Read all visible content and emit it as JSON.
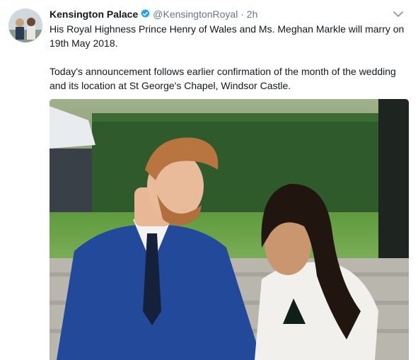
{
  "tweet": {
    "display_name": "Kensington Palace",
    "handle": "@KensingtonRoyal",
    "separator": "·",
    "time": "2h",
    "text_p1": "His Royal Highness Prince Henry of Wales and Ms. Meghan Markle will marry on 19th May 2018.",
    "text_p2": "Today's announcement follows earlier confirmation of the month of the wedding and its location at St George's Chapel, Windsor Castle."
  },
  "icons": {
    "verified": "verified-badge-icon",
    "caret": "chevron-down-icon"
  },
  "colors": {
    "verified_blue": "#1da1f2",
    "secondary_text": "#657786",
    "primary_text": "#14171a"
  }
}
